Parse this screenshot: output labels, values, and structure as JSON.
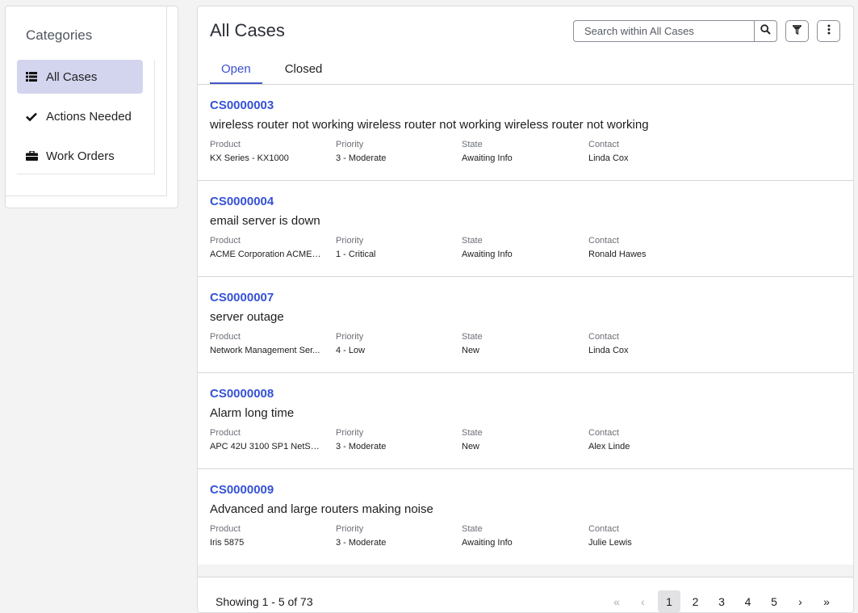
{
  "sidebar": {
    "title": "Categories",
    "items": [
      {
        "label": "All Cases",
        "icon": "list-icon",
        "active": true
      },
      {
        "label": "Actions Needed",
        "icon": "checkmark-icon",
        "active": false
      },
      {
        "label": "Work Orders",
        "icon": "briefcase-icon",
        "active": false
      }
    ]
  },
  "main": {
    "title": "All Cases",
    "search_placeholder": "Search within All Cases",
    "tabs": [
      {
        "label": "Open",
        "active": true
      },
      {
        "label": "Closed",
        "active": false
      }
    ],
    "field_labels": {
      "product": "Product",
      "priority": "Priority",
      "state": "State",
      "contact": "Contact"
    },
    "cases": [
      {
        "number": "CS0000003",
        "description": "wireless router not working wireless router not working wireless router not working",
        "product": "KX Series - KX1000",
        "priority": "3 - Moderate",
        "state": "Awaiting Info",
        "contact": "Linda Cox"
      },
      {
        "number": "CS0000004",
        "description": "email server is down",
        "product": "ACME Corporation ACME ...",
        "priority": "1 - Critical",
        "state": "Awaiting Info",
        "contact": "Ronald Hawes"
      },
      {
        "number": "CS0000007",
        "description": "server outage",
        "product": "Network Management Ser...",
        "priority": "4 - Low",
        "state": "New",
        "contact": "Linda Cox"
      },
      {
        "number": "CS0000008",
        "description": "Alarm long time",
        "product": "APC 42U 3100 SP1 NetSh...",
        "priority": "3 - Moderate",
        "state": "New",
        "contact": "Alex Linde"
      },
      {
        "number": "CS0000009",
        "description": "Advanced and large routers making noise",
        "product": "Iris 5875",
        "priority": "3 - Moderate",
        "state": "Awaiting Info",
        "contact": "Julie Lewis"
      }
    ],
    "footer": {
      "showing": "Showing 1 - 5 of 73",
      "pages": [
        "1",
        "2",
        "3",
        "4",
        "5"
      ],
      "current_page": "1",
      "first_glyph": "«",
      "prev_glyph": "‹",
      "next_glyph": "›",
      "last_glyph": "»"
    }
  },
  "colors": {
    "accent": "#3552d6",
    "active_category_bg": "#d3d4ee",
    "active_tab": "#3a4fd0"
  }
}
